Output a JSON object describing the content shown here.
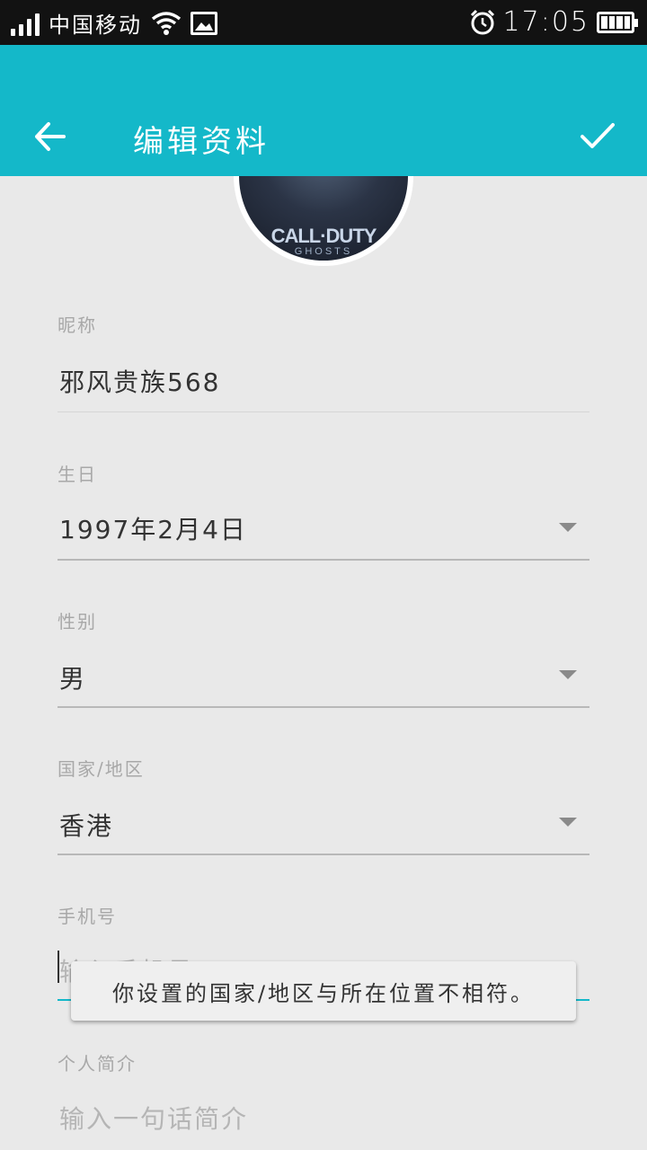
{
  "status_bar": {
    "carrier": "中国移动",
    "time": "17:05"
  },
  "app_bar": {
    "title": "编辑资料",
    "back_icon": "arrow-left-icon",
    "confirm_icon": "check-icon",
    "color": "#14b8c9"
  },
  "avatar": {
    "game_title": "CALL·DUTY",
    "game_sub": "GHOSTS"
  },
  "form": {
    "nickname": {
      "label": "昵称",
      "value": "邪风贵族568"
    },
    "birthday": {
      "label": "生日",
      "value": "1997年2月4日"
    },
    "gender": {
      "label": "性别",
      "value": "男"
    },
    "region": {
      "label": "国家/地区",
      "value": "香港"
    },
    "phone": {
      "label": "手机号",
      "placeholder": "输入手机号"
    },
    "bio": {
      "label": "个人简介",
      "placeholder": "输入一句话简介"
    }
  },
  "toast": {
    "message": "你设置的国家/地区与所在位置不相符。"
  }
}
